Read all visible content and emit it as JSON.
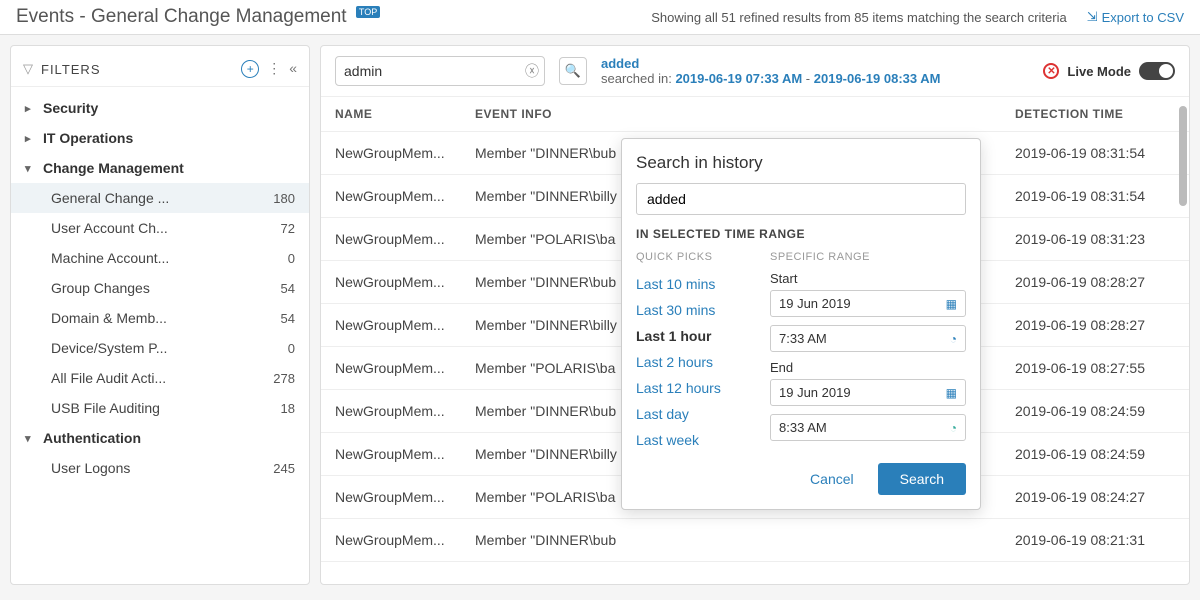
{
  "header": {
    "title": "Events - General Change Management",
    "badge": "TOP",
    "subtitle": "Showing all 51 refined results from 85 items matching the search criteria",
    "export_label": "Export to CSV"
  },
  "filters": {
    "title": "FILTERS",
    "groups": [
      {
        "label": "Security",
        "expanded": false
      },
      {
        "label": "IT Operations",
        "expanded": false
      },
      {
        "label": "Change Management",
        "expanded": true,
        "children": [
          {
            "label": "General Change ...",
            "count": "180",
            "active": true
          },
          {
            "label": "User Account Ch...",
            "count": "72"
          },
          {
            "label": "Machine Account...",
            "count": "0"
          },
          {
            "label": "Group Changes",
            "count": "54"
          },
          {
            "label": "Domain & Memb...",
            "count": "54"
          },
          {
            "label": "Device/System P...",
            "count": "0"
          },
          {
            "label": "All File Audit Acti...",
            "count": "278"
          },
          {
            "label": "USB File Auditing",
            "count": "18"
          }
        ]
      },
      {
        "label": "Authentication",
        "expanded": true,
        "children": [
          {
            "label": "User Logons",
            "count": "245"
          }
        ]
      }
    ]
  },
  "search": {
    "value": "admin",
    "term": "added",
    "searched_in_label": "searched in:",
    "range_start": "2019-06-19 07:33 AM",
    "range_sep": "-",
    "range_end": "2019-06-19 08:33 AM"
  },
  "livemode": {
    "label": "Live Mode"
  },
  "table": {
    "columns": {
      "name": "NAME",
      "info": "EVENT INFO",
      "time": "DETECTION TIME"
    },
    "rows": [
      {
        "name": "NewGroupMem...",
        "info": "Member \"DINNER\\bub",
        "time": "2019-06-19 08:31:54"
      },
      {
        "name": "NewGroupMem...",
        "info": "Member \"DINNER\\billy",
        "time": "2019-06-19 08:31:54"
      },
      {
        "name": "NewGroupMem...",
        "info": "Member \"POLARIS\\ba",
        "time": "2019-06-19 08:31:23"
      },
      {
        "name": "NewGroupMem...",
        "info": "Member \"DINNER\\bub",
        "time": "2019-06-19 08:28:27"
      },
      {
        "name": "NewGroupMem...",
        "info": "Member \"DINNER\\billy",
        "time": "2019-06-19 08:28:27"
      },
      {
        "name": "NewGroupMem...",
        "info": "Member \"POLARIS\\ba",
        "time": "2019-06-19 08:27:55"
      },
      {
        "name": "NewGroupMem...",
        "info": "Member \"DINNER\\bub",
        "time": "2019-06-19 08:24:59"
      },
      {
        "name": "NewGroupMem...",
        "info": "Member \"DINNER\\billy",
        "time": "2019-06-19 08:24:59"
      },
      {
        "name": "NewGroupMem...",
        "info": "Member \"POLARIS\\ba",
        "time": "2019-06-19 08:24:27"
      },
      {
        "name": "NewGroupMem...",
        "info": "Member \"DINNER\\bub",
        "time": "2019-06-19 08:21:31"
      }
    ]
  },
  "popover": {
    "title": "Search in history",
    "input_value": "added",
    "subheader": "IN SELECTED TIME RANGE",
    "quick_picks_label": "QUICK PICKS",
    "quick_picks": [
      {
        "label": "Last 10 mins"
      },
      {
        "label": "Last 30 mins"
      },
      {
        "label": "Last 1 hour",
        "selected": true
      },
      {
        "label": "Last 2 hours"
      },
      {
        "label": "Last 12 hours"
      },
      {
        "label": "Last day"
      },
      {
        "label": "Last week"
      }
    ],
    "specific_range_label": "SPECIFIC RANGE",
    "start_label": "Start",
    "start_date": "19 Jun 2019",
    "start_time": "7:33 AM",
    "end_label": "End",
    "end_date": "19 Jun 2019",
    "end_time": "8:33 AM",
    "cancel_label": "Cancel",
    "search_label": "Search"
  }
}
